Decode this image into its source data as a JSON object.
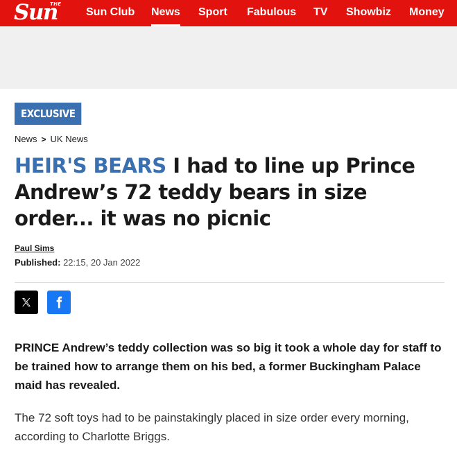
{
  "brand": {
    "logo_small": "THE",
    "logo_main": "Sun"
  },
  "nav": {
    "items": [
      {
        "label": "Sun Club"
      },
      {
        "label": "News",
        "active": true
      },
      {
        "label": "Sport"
      },
      {
        "label": "Fabulous"
      },
      {
        "label": "TV"
      },
      {
        "label": "Showbiz"
      },
      {
        "label": "Money"
      }
    ]
  },
  "article": {
    "badge": "EXCLUSIVE",
    "breadcrumb": [
      "News",
      "UK News"
    ],
    "kicker": "HEIR'S BEARS",
    "headline": "I had to line up Prince Andrew’s 72 teddy bears in size order... it was no picnic",
    "author": "Paul Sims",
    "published_label": "Published:",
    "published_value": "22:15, 20 Jan 2022",
    "lead": "PRINCE Andrew’s teddy collection was so big it took a whole day for staff to be trained how to arrange them on his bed, a former Buckingham Palace maid has revealed.",
    "paragraph1": "The 72 soft toys had to be painstakingly placed in size order every morning, according to Charlotte Briggs."
  },
  "share": {
    "icons": [
      "x-icon",
      "facebook-icon"
    ]
  },
  "colors": {
    "brand_red": "#e2130f",
    "accent_blue": "#3a6fb0",
    "facebook_blue": "#1877f2"
  }
}
